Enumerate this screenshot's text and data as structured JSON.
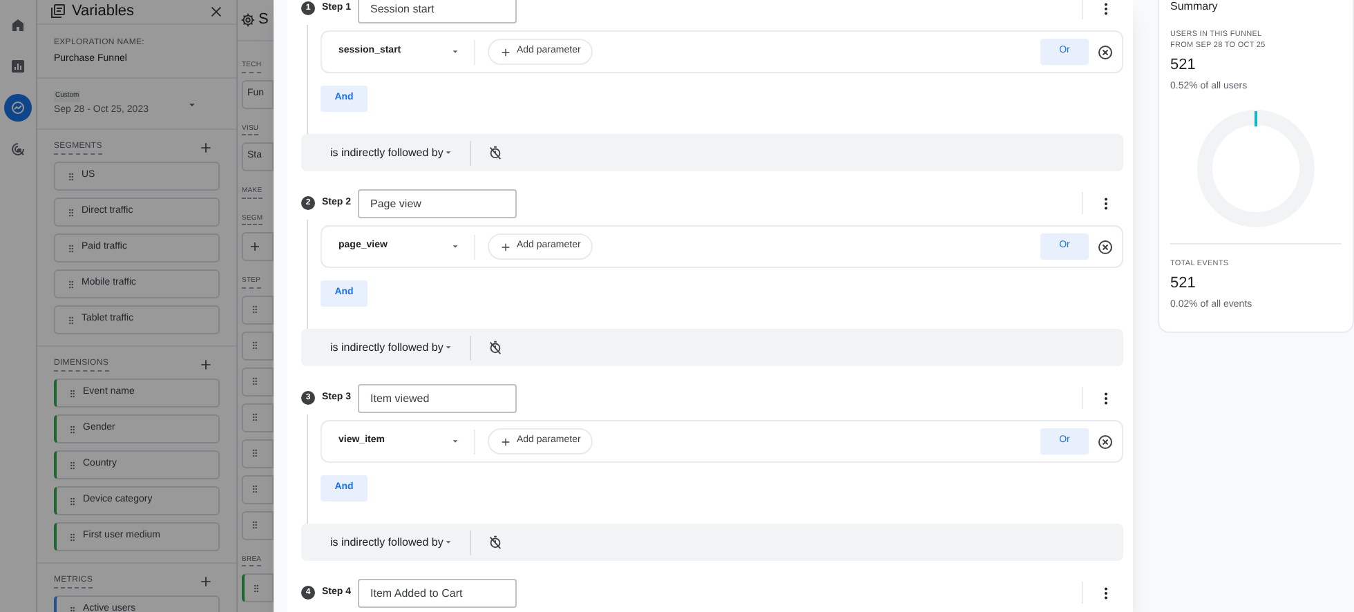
{
  "nav_rail": {
    "items": [
      {
        "kind": "home",
        "selected": false
      },
      {
        "kind": "reports",
        "selected": false
      },
      {
        "kind": "explore",
        "selected": true
      },
      {
        "kind": "advertising",
        "selected": false
      }
    ]
  },
  "variables_panel": {
    "title": "Variables",
    "exploration_name_label": "EXPLORATION NAME:",
    "exploration_name": "Purchase Funnel",
    "date_range": {
      "label": "Custom",
      "value": "Sep 28 - Oct 25, 2023"
    },
    "segments": {
      "heading": "SEGMENTS",
      "items": [
        "US",
        "Direct traffic",
        "Paid traffic",
        "Mobile traffic",
        "Tablet traffic"
      ]
    },
    "dimensions": {
      "heading": "DIMENSIONS",
      "items": [
        "Event name",
        "Gender",
        "Country",
        "Device category",
        "First user medium"
      ]
    },
    "metrics": {
      "heading": "METRICS",
      "items": [
        "Active users"
      ]
    }
  },
  "settings_panel": {
    "title": "S",
    "items": [
      {
        "kind": "heading",
        "text": "TECH"
      },
      {
        "kind": "field",
        "text": "Fun"
      },
      {
        "kind": "heading",
        "text": "VISU"
      },
      {
        "kind": "field",
        "text": "Sta"
      },
      {
        "kind": "heading",
        "text": "MAKE"
      },
      {
        "kind": "heading",
        "text": "SEGM"
      },
      {
        "kind": "add"
      },
      {
        "kind": "heading",
        "text": "STEP"
      },
      {
        "kind": "drag"
      },
      {
        "kind": "drag"
      },
      {
        "kind": "drag"
      },
      {
        "kind": "drag"
      },
      {
        "kind": "drag"
      },
      {
        "kind": "drag"
      },
      {
        "kind": "drag"
      },
      {
        "kind": "heading",
        "text": "BREA"
      },
      {
        "kind": "dimension"
      }
    ]
  },
  "funnel_steps": [
    {
      "number": "1",
      "label": "Step 1",
      "name": "Session start",
      "event": "session_start",
      "add_parameter": "Add parameter",
      "or": "Or",
      "and": "And",
      "connector": "is indirectly followed by"
    },
    {
      "number": "2",
      "label": "Step 2",
      "name": "Page view",
      "event": "page_view",
      "add_parameter": "Add parameter",
      "or": "Or",
      "and": "And",
      "connector": "is indirectly followed by"
    },
    {
      "number": "3",
      "label": "Step 3",
      "name": "Item viewed",
      "event": "view_item",
      "add_parameter": "Add parameter",
      "or": "Or",
      "and": "And",
      "connector": "is indirectly followed by"
    },
    {
      "number": "4",
      "label": "Step 4",
      "name": "Item Added to Cart"
    }
  ],
  "summary": {
    "title": "Summary",
    "metrics": [
      {
        "label": "USERS IN THIS FUNNEL\nFROM SEP 28 TO OCT 25",
        "value": "521",
        "share": "0.52% of all users",
        "donut": true
      },
      {
        "label": "TOTAL EVENTS",
        "value": "521",
        "share": "0.02% of all events",
        "donut": false
      }
    ]
  }
}
